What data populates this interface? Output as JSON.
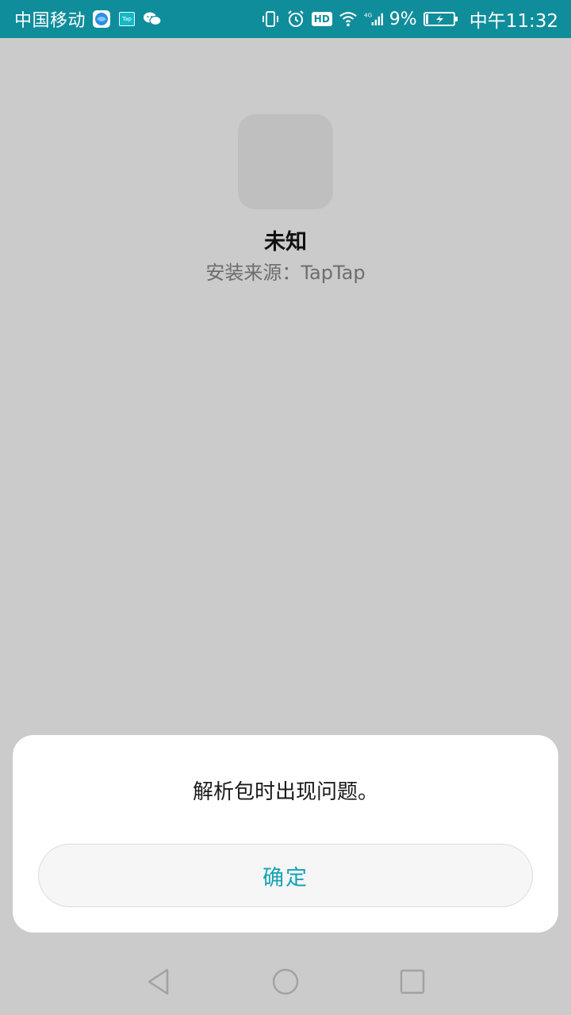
{
  "status_bar": {
    "carrier": "中国移动",
    "tap_badge": "Tap",
    "hd_label": "HD",
    "network": "4G",
    "battery": "9%",
    "time": "中午11:32",
    "icons": [
      "app-globe-icon",
      "taptap-icon",
      "wechat-icon",
      "vibrate-icon",
      "alarm-icon",
      "hd-icon",
      "wifi-icon",
      "signal-icon",
      "battery-charging-icon"
    ]
  },
  "app": {
    "name": "未知",
    "install_source": "安装来源：TapTap"
  },
  "dialog": {
    "message": "解析包时出现问题。",
    "confirm_label": "确定"
  },
  "colors": {
    "status_bar": "#0f8d9b",
    "background": "#cbcbcb",
    "accent": "#14a3b4"
  },
  "nav": {
    "icons": [
      "back-icon",
      "home-icon",
      "recent-apps-icon"
    ]
  }
}
